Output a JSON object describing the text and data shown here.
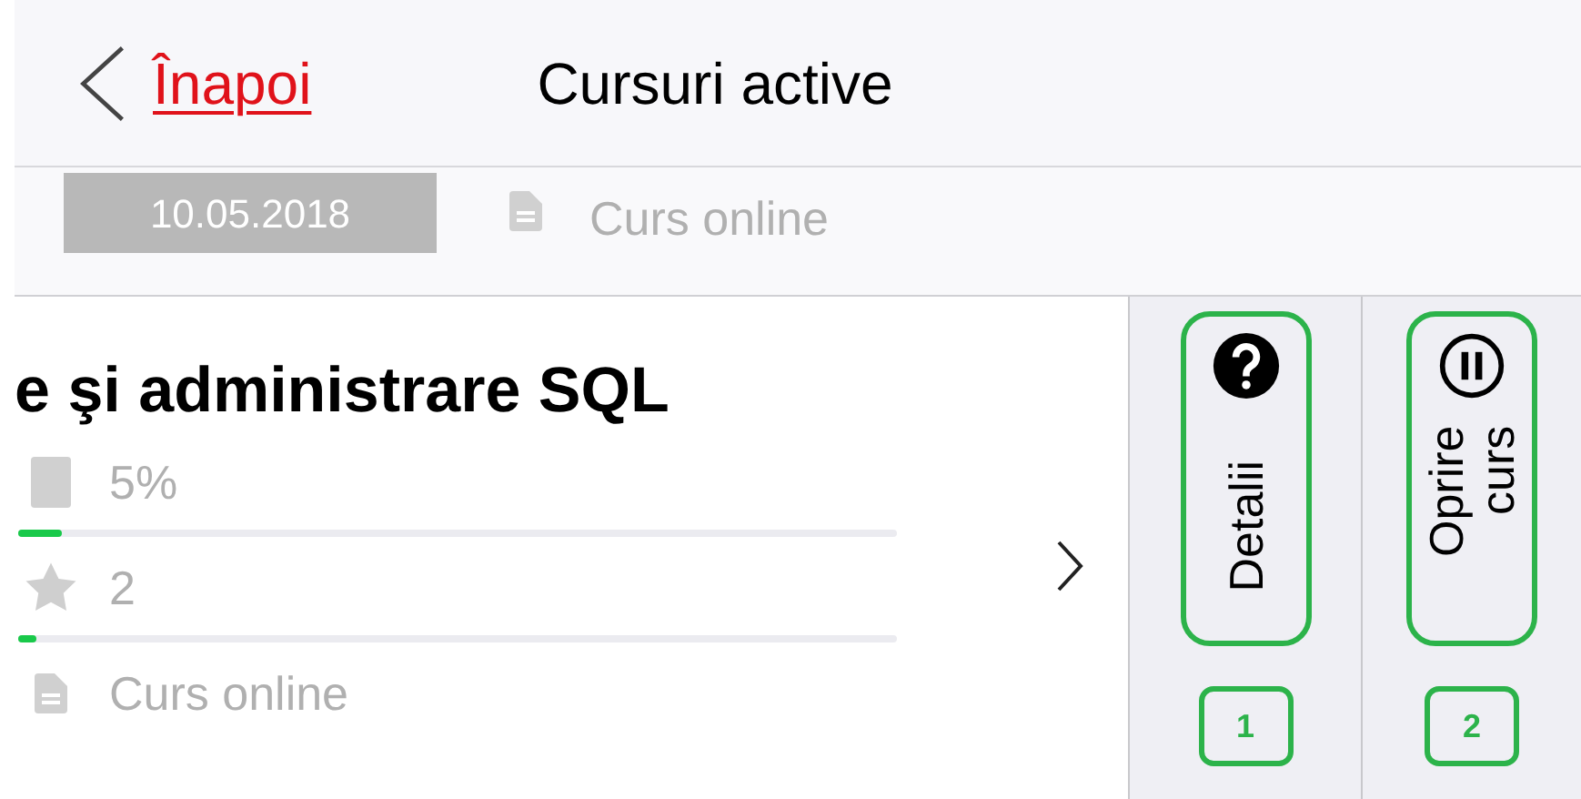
{
  "header": {
    "back_label": "Înapoi",
    "title": "Cursuri active"
  },
  "previous_item": {
    "date": "10.05.2018",
    "type_label": "Curs online"
  },
  "course": {
    "title": "e şi administrare SQL",
    "stats": [
      {
        "kind": "progress",
        "value": "5%",
        "level": 0.05
      },
      {
        "kind": "stars",
        "value": "2",
        "level": 0.02
      },
      {
        "kind": "type",
        "value": "Curs online"
      }
    ]
  },
  "actions": [
    {
      "kind": "help",
      "label": "Detalii",
      "number": "1"
    },
    {
      "kind": "pause",
      "label": "Oprire curs",
      "number": "2"
    }
  ]
}
